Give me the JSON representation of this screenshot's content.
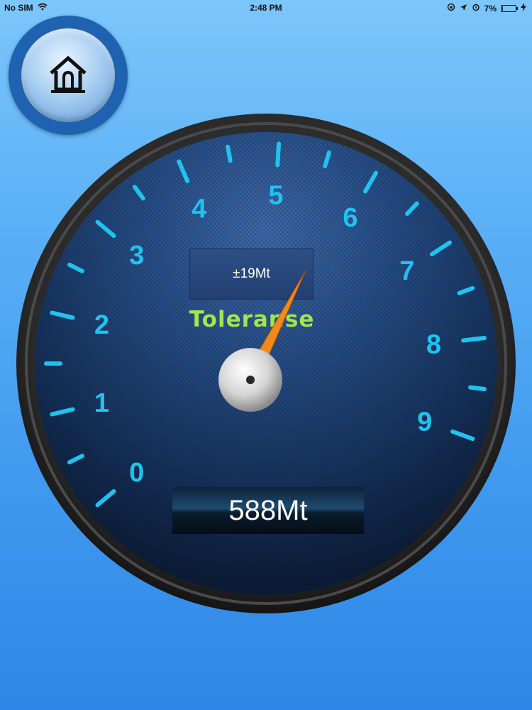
{
  "status_bar": {
    "carrier": "No SIM",
    "time": "2:48 PM",
    "battery_percent": "7%",
    "battery_level": 0.07,
    "icons": [
      "wifi-icon",
      "rotation-lock-icon",
      "location-arrow-icon",
      "alarm-icon",
      "battery-icon",
      "charging-bolt-icon"
    ]
  },
  "home_button": {
    "icon": "home-icon"
  },
  "gauge": {
    "scale_min": 0,
    "scale_max": 9,
    "scale_labels": [
      "0",
      "1",
      "2",
      "3",
      "4",
      "5",
      "6",
      "7",
      "8",
      "9"
    ],
    "needle_value": 5.88,
    "tolerance_value": "±19Mt",
    "tolerance_label": "Toleranse",
    "reading": "588Mt",
    "colors": {
      "tick": "#1ec3f0",
      "needle": "#f08a1a",
      "tolerance_label": "#9ee84a"
    }
  }
}
